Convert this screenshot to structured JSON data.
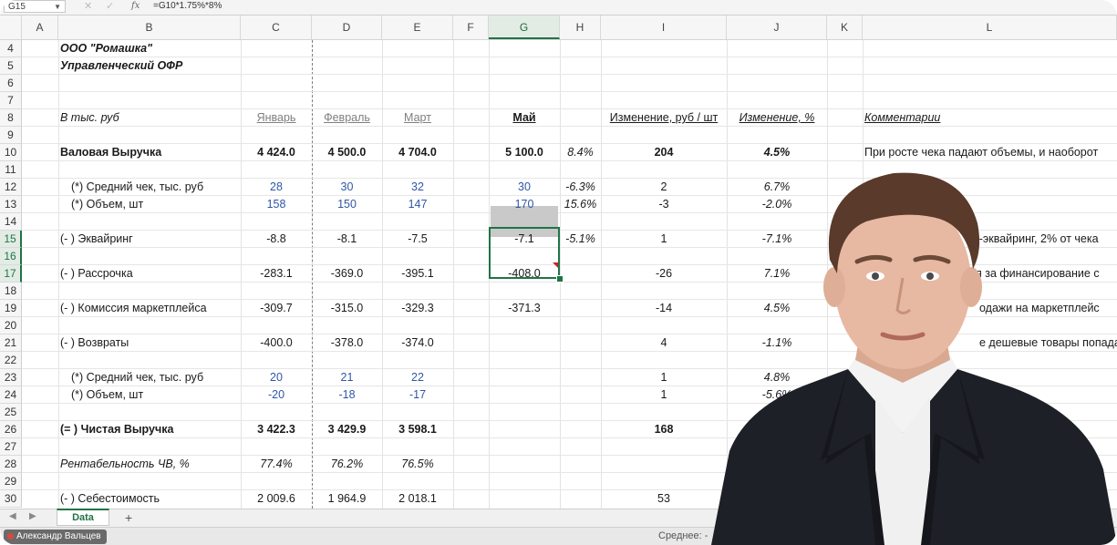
{
  "formula_bar": {
    "cell_ref": "G15",
    "formula": "=G10*1.75%*8%",
    "fx_label": "fx"
  },
  "columns": [
    "A",
    "B",
    "C",
    "D",
    "E",
    "F",
    "G",
    "H",
    "I",
    "J",
    "K",
    "L"
  ],
  "selected_column": "G",
  "rows": [
    "4",
    "5",
    "6",
    "7",
    "8",
    "9",
    "10",
    "11",
    "12",
    "13",
    "14",
    "15",
    "16",
    "17",
    "18",
    "19",
    "20",
    "21",
    "22",
    "23",
    "24",
    "25",
    "26",
    "27",
    "28",
    "29",
    "30"
  ],
  "selected_rows": [
    "15",
    "16",
    "17"
  ],
  "cells": {
    "company": "ООО \"Ромашка\"",
    "report": "Управленческий ОФР",
    "units": "В тыс. руб",
    "h_jan": "Январь",
    "h_feb": "Февраль",
    "h_mar": "Март",
    "h_may": "Май",
    "h_change_rub": "Изменение, руб / шт",
    "h_change_pct": "Изменение, %",
    "h_comments": "Комментарии",
    "r10_label": "Валовая Выручка",
    "r10": [
      "4 424.0",
      "4 500.0",
      "4 704.0",
      "5 100.0",
      "8.4%",
      "204",
      "4.5%"
    ],
    "r10_comment": "При росте чека падают объемы, и наоборот",
    "r12_label": "(*) Средний чек, тыс. руб",
    "r12": [
      "28",
      "30",
      "32",
      "30",
      "-6.3%",
      "2",
      "6.7%"
    ],
    "r13_label": "(*) Объем, шт",
    "r13": [
      "158",
      "150",
      "147",
      "170",
      "15.6%",
      "-3",
      "-2.0%"
    ],
    "r15_label": "(- ) Эквайринг",
    "r15": [
      "-8.8",
      "-8.1",
      "-7.5",
      "-7.1",
      "-5.1%",
      "1",
      "-7.1%"
    ],
    "r15_comment": "т-эквайринг, 2% от чека",
    "r17_label": "(- ) Рассрочка",
    "r17": [
      "-283.1",
      "-369.0",
      "-395.1",
      "-408.0",
      "-26",
      "7.1%"
    ],
    "r17_comment": "я за финансирование с",
    "r19_label": "(- ) Комиссия маркетплейса",
    "r19": [
      "-309.7",
      "-315.0",
      "-329.3",
      "-371.3",
      "-14",
      "4.5%"
    ],
    "r19_comment": "одажи на маркетплейс",
    "r21_label": "(- ) Возвраты",
    "r21": [
      "-400.0",
      "-378.0",
      "-374.0",
      "4",
      "-1.1%"
    ],
    "r21_comment": "е дешевые товары попада",
    "r23_label": "(*) Средний чек, тыс. руб",
    "r23": [
      "20",
      "21",
      "22",
      "1",
      "4.8%"
    ],
    "r24_label": "(*) Объем, шт",
    "r24": [
      "-20",
      "-18",
      "-17",
      "1",
      "-5.6%"
    ],
    "r26_label": "(= ) Чистая Выручка",
    "r26": [
      "3 422.3",
      "3 429.9",
      "3 598.1",
      "168"
    ],
    "r28_label": "Рентабельность ЧВ, %",
    "r28": [
      "77.4%",
      "76.2%",
      "76.5%"
    ],
    "r30_label": "(- ) Себестоимость",
    "r30": [
      "2 009.6",
      "1 964.9",
      "2 018.1",
      "53"
    ]
  },
  "sheet_tabs": {
    "active": "Data",
    "add": "+"
  },
  "status": {
    "user": "Александр Вальцев",
    "average": "Среднее: -"
  },
  "colors": {
    "excel_green": "#217346",
    "input_blue": "#2f56a8"
  }
}
